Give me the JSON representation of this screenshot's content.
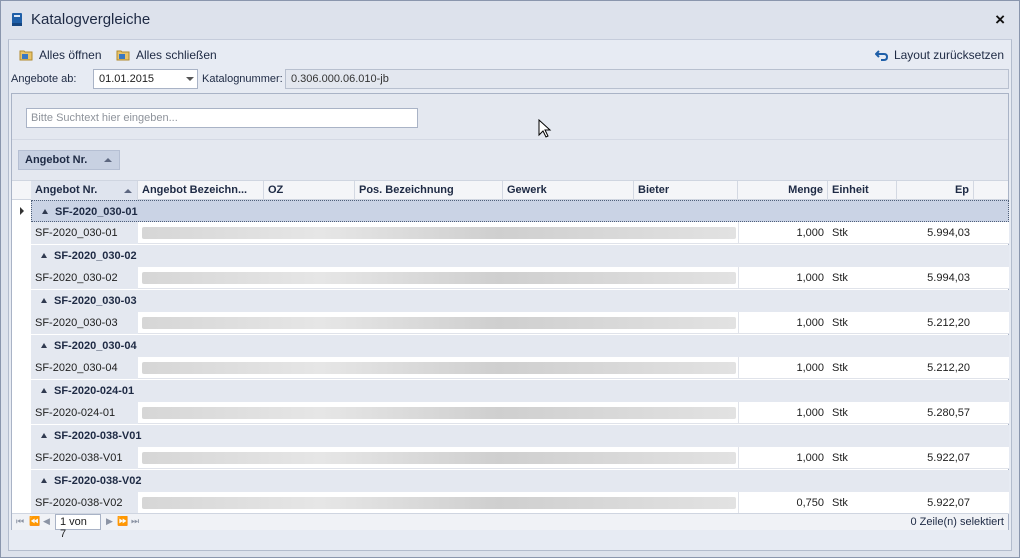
{
  "window": {
    "title": "Katalogvergleiche",
    "close_label": "×"
  },
  "toolbar": {
    "open_all": "Alles öffnen",
    "close_all": "Alles schließen",
    "reset_layout": "Layout zurücksetzen"
  },
  "filters": {
    "offers_from_label": "Angebote ab:",
    "offers_from_value": "01.01.2015",
    "catalog_label": "Katalognummer:",
    "catalog_value": "0.306.000.06.010-jb"
  },
  "search": {
    "placeholder": "Bitte Suchtext hier eingeben..."
  },
  "group_panel": {
    "chip_label": "Angebot Nr."
  },
  "columns": [
    "Angebot Nr.",
    "Angebot Bezeichn...",
    "OZ",
    "Pos. Bezeichnung",
    "Gewerk",
    "Bieter",
    "Menge",
    "Einheit",
    "Ep"
  ],
  "groups": [
    {
      "label": "SF-2020_030-01",
      "row": {
        "nr": "SF-2020_030-01",
        "menge": "1,000",
        "einheit": "Stk",
        "ep": "5.994,03"
      }
    },
    {
      "label": "SF-2020_030-02",
      "row": {
        "nr": "SF-2020_030-02",
        "menge": "1,000",
        "einheit": "Stk",
        "ep": "5.994,03"
      }
    },
    {
      "label": "SF-2020_030-03",
      "row": {
        "nr": "SF-2020_030-03",
        "menge": "1,000",
        "einheit": "Stk",
        "ep": "5.212,20"
      }
    },
    {
      "label": "SF-2020_030-04",
      "row": {
        "nr": "SF-2020_030-04",
        "menge": "1,000",
        "einheit": "Stk",
        "ep": "5.212,20"
      }
    },
    {
      "label": "SF-2020-024-01",
      "row": {
        "nr": "SF-2020-024-01",
        "menge": "1,000",
        "einheit": "Stk",
        "ep": "5.280,57"
      }
    },
    {
      "label": "SF-2020-038-V01",
      "row": {
        "nr": "SF-2020-038-V01",
        "menge": "1,000",
        "einheit": "Stk",
        "ep": "5.922,07"
      }
    },
    {
      "label": "SF-2020-038-V02",
      "row": {
        "nr": "SF-2020-038-V02",
        "menge": "0,750",
        "einheit": "Stk",
        "ep": "5.922,07"
      }
    }
  ],
  "footer": {
    "page": "1 von 7",
    "status": "0 Zeile(n) selektiert"
  },
  "colors": {
    "accent": "#1f5fa8",
    "group_row": "#e4e8f0",
    "selected_group": "#cad3e5"
  }
}
